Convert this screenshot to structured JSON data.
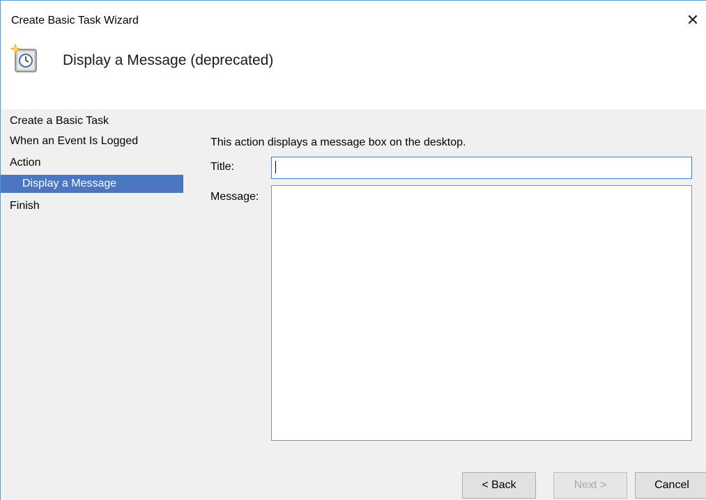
{
  "window": {
    "title": "Create Basic Task Wizard",
    "close_glyph": "✕",
    "accent_color": "#4a9be0"
  },
  "header": {
    "icon": "task-scheduler-clock-icon",
    "heading": "Display a Message (deprecated)"
  },
  "nav": {
    "items": [
      {
        "label": "Create a Basic Task",
        "selected": false
      },
      {
        "label": "When an Event Is Logged",
        "selected": false
      },
      {
        "label": "Action",
        "selected": false
      },
      {
        "label": "Display a Message",
        "selected": true
      },
      {
        "label": "Finish",
        "selected": false
      }
    ],
    "selected_color": "#4a76c2"
  },
  "form": {
    "description": "This action displays a message box on the desktop.",
    "title_label": "Title:",
    "title_value": "",
    "message_label": "Message:",
    "message_value": ""
  },
  "buttons": {
    "back": "< Back",
    "next": "Next >",
    "cancel": "Cancel"
  }
}
